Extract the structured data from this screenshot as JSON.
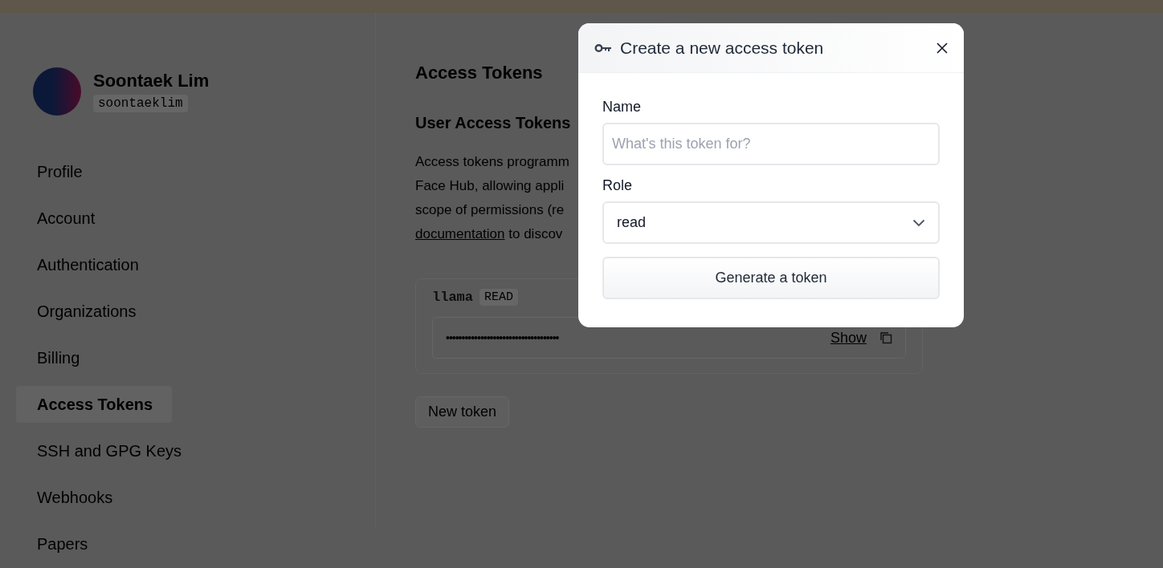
{
  "profile": {
    "name": "Soontaek Lim",
    "username": "soontaeklim"
  },
  "sidebar": {
    "items": [
      {
        "label": "Profile",
        "selected": false
      },
      {
        "label": "Account",
        "selected": false
      },
      {
        "label": "Authentication",
        "selected": false
      },
      {
        "label": "Organizations",
        "selected": false
      },
      {
        "label": "Billing",
        "selected": false
      },
      {
        "label": "Access Tokens",
        "selected": true
      },
      {
        "label": "SSH and GPG Keys",
        "selected": false
      },
      {
        "label": "Webhooks",
        "selected": false
      },
      {
        "label": "Papers",
        "selected": false
      }
    ]
  },
  "main": {
    "title": "Access Tokens",
    "section_title": "User Access Tokens",
    "description": {
      "lines": [
        "Access tokens programm",
        "Face Hub, allowing appli",
        "scope of permissions (re"
      ],
      "link": "documentation",
      "tail": "to discov"
    },
    "tokens": [
      {
        "name": "llama",
        "role": "READ",
        "value": "••••••••••••••••••••••••••••••••••••",
        "show": "Show"
      }
    ],
    "new_token_button": "New token"
  },
  "modal": {
    "title": "Create a new access token",
    "name_label": "Name",
    "name_placeholder": "What's this token for?",
    "role_label": "Role",
    "role_value": "read",
    "submit": "Generate a token"
  }
}
